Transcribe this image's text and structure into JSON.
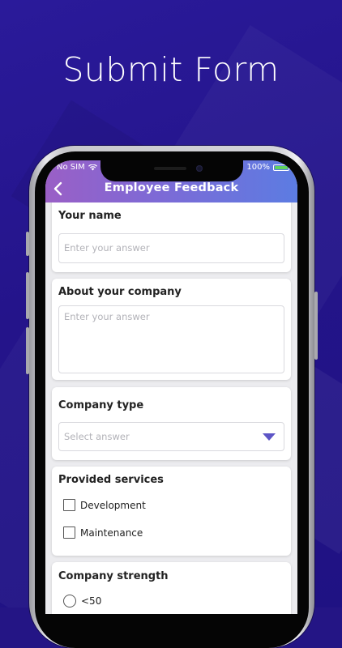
{
  "promo": {
    "headline": "Submit Form"
  },
  "status_bar": {
    "carrier": "No SIM",
    "battery": "100%"
  },
  "header": {
    "title": "Employee Feedback"
  },
  "form": {
    "your_name": {
      "label": "Your name",
      "placeholder": "Enter your answer"
    },
    "about_company": {
      "label": "About your company",
      "placeholder": "Enter your answer"
    },
    "company_type": {
      "label": "Company type",
      "placeholder": "Select answer"
    },
    "provided_services": {
      "label": "Provided services",
      "options": [
        "Development",
        "Maintenance"
      ]
    },
    "company_strength": {
      "label": "Company strength",
      "options": [
        "<50"
      ]
    }
  },
  "colors": {
    "background": "#241585",
    "header_gradient_start": "#9a5fc6",
    "header_gradient_end": "#5c7ce2",
    "accent": "#5d55c6"
  }
}
